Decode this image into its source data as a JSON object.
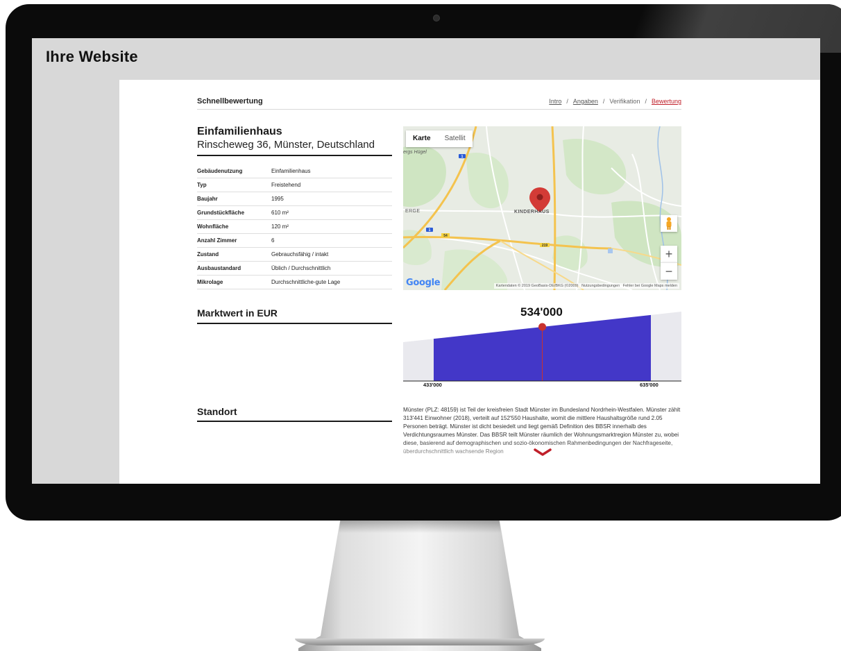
{
  "screen": {
    "title": "Ihre Website"
  },
  "site": {
    "brand": "Schnellbewertung",
    "breadcrumbs": [
      {
        "label": "Intro",
        "state": "link"
      },
      {
        "label": "Angaben",
        "state": "link"
      },
      {
        "label": "Verifikation",
        "state": "plain"
      },
      {
        "label": "Bewertung",
        "state": "active"
      }
    ],
    "separator": "/"
  },
  "property": {
    "type": "Einfamilienhaus",
    "address": "Rinscheweg 36, Münster, Deutschland",
    "facts": [
      {
        "key": "Gebäudenutzung",
        "value": "Einfamilienhaus"
      },
      {
        "key": "Typ",
        "value": "Freistehend"
      },
      {
        "key": "Baujahr",
        "value": "1995"
      },
      {
        "key": "Grundstückfläche",
        "value": "610 m²"
      },
      {
        "key": "Wohnfläche",
        "value": "120 m²"
      },
      {
        "key": "Anzahl Zimmer",
        "value": "6"
      },
      {
        "key": "Zustand",
        "value": "Gebrauchsfähig / intakt"
      },
      {
        "key": "Ausbaustandard",
        "value": "Üblich / Durchschnittlich"
      },
      {
        "key": "Mikrolage",
        "value": "Durchschnittliche-gute Lage"
      }
    ]
  },
  "map": {
    "tabs": [
      "Karte",
      "Satellit"
    ],
    "active_tab": "Karte",
    "labels": {
      "district": "KINDERHAUS",
      "edge": "ERGE",
      "corner": "ergs Hügel"
    },
    "road_badges": [
      "1",
      "1",
      "54",
      "219"
    ],
    "zoom_in": "+",
    "zoom_out": "−",
    "logo": "Google",
    "footer": {
      "data": "Kartendaten © 2019 GeoBasis-DE/BKG (©2009)",
      "terms": "Nutzungsbedingungen",
      "report": "Fehler bei Google Maps melden"
    },
    "icons": {
      "marker": "map-marker-icon",
      "pegman": "pegman-icon"
    },
    "colors": {
      "marker": "#d33b36"
    }
  },
  "valuation": {
    "title": "Marktwert in EUR",
    "value_label": "534'000",
    "low_label": "433'000",
    "high_label": "635'000",
    "value": 534000,
    "low": 433000,
    "high": 635000,
    "colors": {
      "band": "#4337c8",
      "marker": "#c8322f",
      "bg": "#e9e9ee"
    }
  },
  "location": {
    "title": "Standort",
    "text": "Münster (PLZ: 48159) ist Teil der kreisfreien Stadt Münster im Bundesland Nordrhein-Westfalen. Münster zählt 313'441 Einwohner (2018), verteilt auf 152'550 Haushalte, womit die mittlere Haushaltsgröße rund 2.05 Personen beträgt. Münster ist dicht besiedelt und liegt gemäß Definition des BBSR innerhalb des Verdichtungsraumes Münster. Das BBSR teilt Münster räumlich der Wohnungsmarktregion Münster zu, wobei diese, basierend auf demographischen und sozio-ökonomischen Rahmenbedingungen der Nachfrageseite, überdurchschnittlich wachsende Region",
    "expand_icon": "chevron-down-icon"
  }
}
